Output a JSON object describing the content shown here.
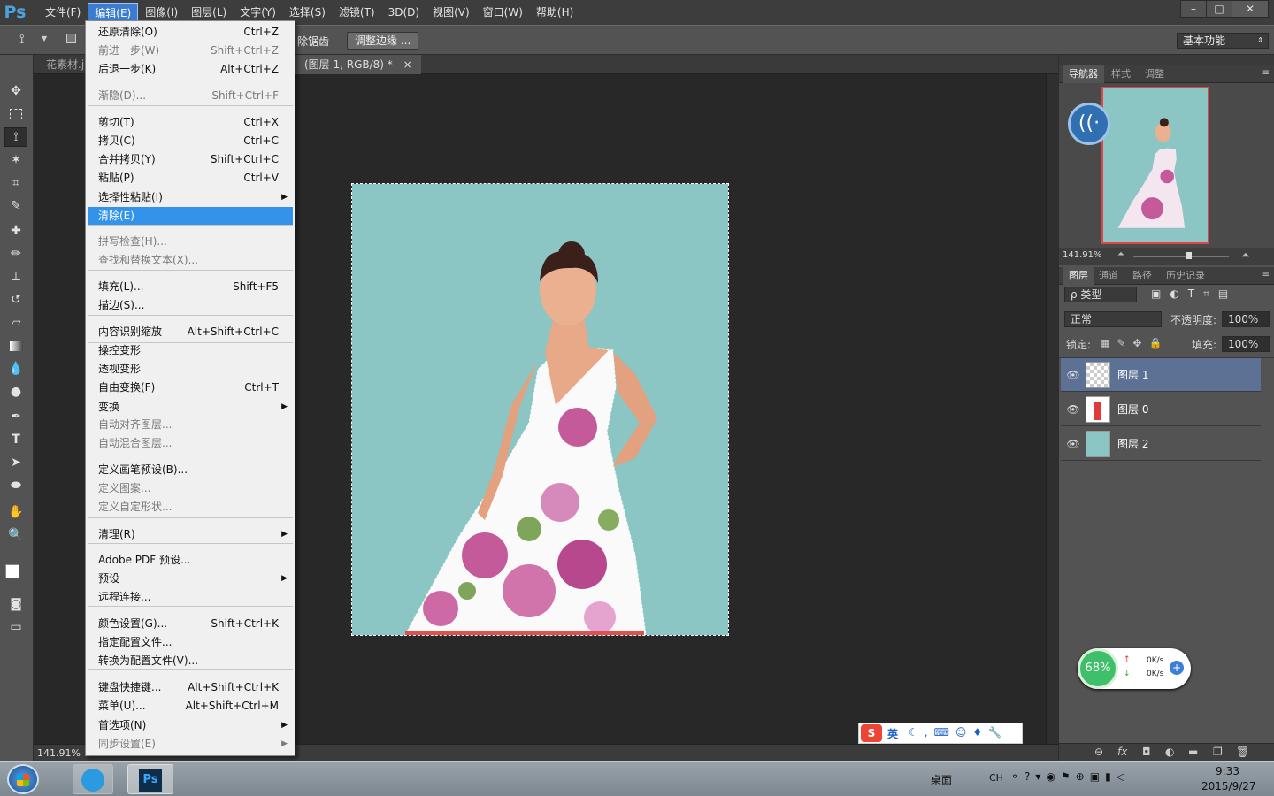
{
  "app": {
    "logo": "Ps"
  },
  "menubar": {
    "items": [
      "文件(F)",
      "编辑(E)",
      "图像(I)",
      "图层(L)",
      "文字(Y)",
      "选择(S)",
      "滤镜(T)",
      "3D(D)",
      "视图(V)",
      "窗口(W)",
      "帮助(H)"
    ],
    "active": "编辑(E)",
    "window_buttons": [
      "–",
      "□",
      "✕"
    ]
  },
  "optionsbar": {
    "partial_text": "除锯齿",
    "refine_edge_button": "调整边缘 ...",
    "workspace": "基本功能"
  },
  "doc_tabs": {
    "tab1": "花素材.j",
    "tab2": "(图层 1, RGB/8) *",
    "close": "×"
  },
  "status": {
    "zoom": "141.91%"
  },
  "navigator": {
    "tabs": [
      "导航器",
      "样式",
      "调整"
    ],
    "zoom": "141.91%"
  },
  "layers_panel": {
    "tabs": [
      "图层",
      "通道",
      "路径",
      "历史记录"
    ],
    "filter_kind": "ρ 类型",
    "blend_mode": "正常",
    "opacity_label": "不透明度:",
    "opacity_value": "100%",
    "lock_label": "锁定:",
    "fill_label": "填充:",
    "fill_value": "100%",
    "layers": [
      {
        "name": "图层 1",
        "selected": true
      },
      {
        "name": "图层 0",
        "selected": false
      },
      {
        "name": "图层 2",
        "selected": false
      }
    ],
    "footer_icons": [
      "link-icon",
      "fx-icon",
      "mask-icon",
      "adjustment-icon",
      "folder-icon",
      "new-layer-icon",
      "trash-icon"
    ]
  },
  "edit_menu": {
    "items": [
      {
        "label": "还原清除(O)",
        "shortcut": "Ctrl+Z",
        "disabled": false
      },
      {
        "label": "前进一步(W)",
        "shortcut": "Shift+Ctrl+Z",
        "disabled": true
      },
      {
        "label": "后退一步(K)",
        "shortcut": "Alt+Ctrl+Z",
        "disabled": false
      },
      {
        "label": "渐隐(D)...",
        "shortcut": "Shift+Ctrl+F",
        "disabled": true
      },
      {
        "label": "剪切(T)",
        "shortcut": "Ctrl+X",
        "disabled": false
      },
      {
        "label": "拷贝(C)",
        "shortcut": "Ctrl+C",
        "disabled": false
      },
      {
        "label": "合并拷贝(Y)",
        "shortcut": "Shift+Ctrl+C",
        "disabled": false
      },
      {
        "label": "粘贴(P)",
        "shortcut": "Ctrl+V",
        "disabled": false
      },
      {
        "label": "选择性粘贴(I)",
        "shortcut": "",
        "disabled": false,
        "submenu": true
      },
      {
        "label": "清除(E)",
        "shortcut": "",
        "disabled": false,
        "highlighted": true
      },
      {
        "label": "拼写检查(H)...",
        "shortcut": "",
        "disabled": true
      },
      {
        "label": "查找和替换文本(X)...",
        "shortcut": "",
        "disabled": true
      },
      {
        "label": "填充(L)...",
        "shortcut": "Shift+F5",
        "disabled": false
      },
      {
        "label": "描边(S)...",
        "shortcut": "",
        "disabled": false
      },
      {
        "label": "内容识别缩放",
        "shortcut": "Alt+Shift+Ctrl+C",
        "disabled": false
      },
      {
        "label": "操控变形",
        "shortcut": "",
        "disabled": false
      },
      {
        "label": "透视变形",
        "shortcut": "",
        "disabled": false
      },
      {
        "label": "自由变换(F)",
        "shortcut": "Ctrl+T",
        "disabled": false
      },
      {
        "label": "变换",
        "shortcut": "",
        "disabled": false,
        "submenu": true
      },
      {
        "label": "自动对齐图层...",
        "shortcut": "",
        "disabled": true
      },
      {
        "label": "自动混合图层...",
        "shortcut": "",
        "disabled": true
      },
      {
        "label": "定义画笔预设(B)...",
        "shortcut": "",
        "disabled": false
      },
      {
        "label": "定义图案...",
        "shortcut": "",
        "disabled": true
      },
      {
        "label": "定义自定形状...",
        "shortcut": "",
        "disabled": true
      },
      {
        "label": "清理(R)",
        "shortcut": "",
        "disabled": false,
        "submenu": true
      },
      {
        "label": "Adobe PDF 预设...",
        "shortcut": "",
        "disabled": false
      },
      {
        "label": "预设",
        "shortcut": "",
        "disabled": false,
        "submenu": true
      },
      {
        "label": "远程连接...",
        "shortcut": "",
        "disabled": false
      },
      {
        "label": "颜色设置(G)...",
        "shortcut": "Shift+Ctrl+K",
        "disabled": false
      },
      {
        "label": "指定配置文件...",
        "shortcut": "",
        "disabled": false
      },
      {
        "label": "转换为配置文件(V)...",
        "shortcut": "",
        "disabled": false
      },
      {
        "label": "键盘快捷键...",
        "shortcut": "Alt+Shift+Ctrl+K",
        "disabled": false
      },
      {
        "label": "菜单(U)...",
        "shortcut": "Alt+Shift+Ctrl+M",
        "disabled": false
      },
      {
        "label": "首选项(N)",
        "shortcut": "",
        "disabled": false,
        "submenu": true
      },
      {
        "label": "同步设置(E)",
        "shortcut": "",
        "disabled": true,
        "submenu": true
      }
    ]
  },
  "network_widget": {
    "percent": "68%",
    "up": "0K/s",
    "down": "0K/s"
  },
  "ime_bar": {
    "mode": "英"
  },
  "taskbar": {
    "desktop_label": "桌面",
    "lang": "CH",
    "time": "9:33",
    "date": "2015/9/27",
    "ps_label": "Ps"
  },
  "colors": {
    "canvas_bg": "#8bc5c4",
    "highlight": "#3393eb",
    "layer_selected": "#5d7195"
  }
}
